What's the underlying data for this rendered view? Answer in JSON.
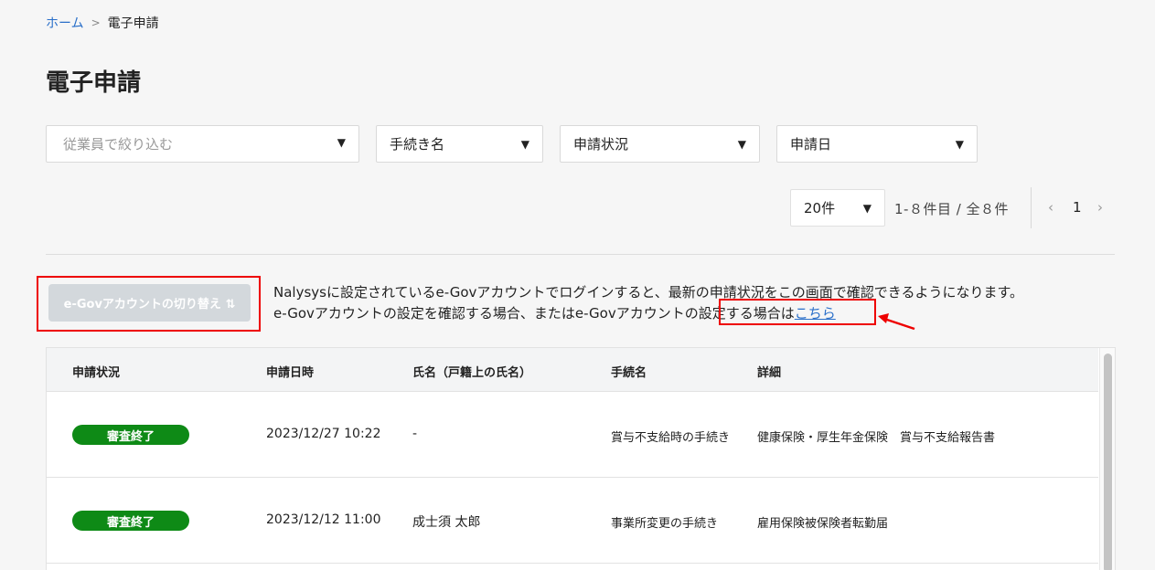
{
  "breadcrumb": {
    "home": "ホーム",
    "separator": ">",
    "current": "電子申請"
  },
  "page": {
    "title": "電子申請"
  },
  "filters": {
    "employee_placeholder": "従業員で絞り込む",
    "procedure": "手続き名",
    "status": "申請状況",
    "date": "申請日"
  },
  "pagination": {
    "per_page": "20件",
    "range": "1-８件目 / 全８件",
    "prev": "‹",
    "page": "1",
    "next": "›"
  },
  "egov": {
    "switch_label": "e-Govアカウントの切り替え ⇅",
    "notice_line1": "Nalysysに設定されているe-Govアカウントでログインすると、最新の申請状況をこの画面で確認できるようになります。",
    "notice_line2": "e-Govアカウントの設定を確認する場合、またはe-Govアカウントの設定する場合は",
    "link": "こちら"
  },
  "table": {
    "headers": [
      "申請状況",
      "申請日時",
      "氏名（戸籍上の氏名）",
      "手続名",
      "詳細"
    ],
    "rows": [
      {
        "status": "審査終了",
        "datetime": "2023/12/27 10:22",
        "name": "-",
        "procedure": "賞与不支給時の手続き",
        "detail": "健康保険・厚生年金保険　賞与不支給報告書"
      },
      {
        "status": "審査終了",
        "datetime": "2023/12/12 11:00",
        "name": "成士須 太郎",
        "procedure": "事業所変更の手続き",
        "detail": "雇用保険被保険者転勤届"
      }
    ]
  },
  "colors": {
    "accent_link": "#2a6fc9",
    "status_done": "#0e8a16",
    "highlight": "#ee0000"
  }
}
